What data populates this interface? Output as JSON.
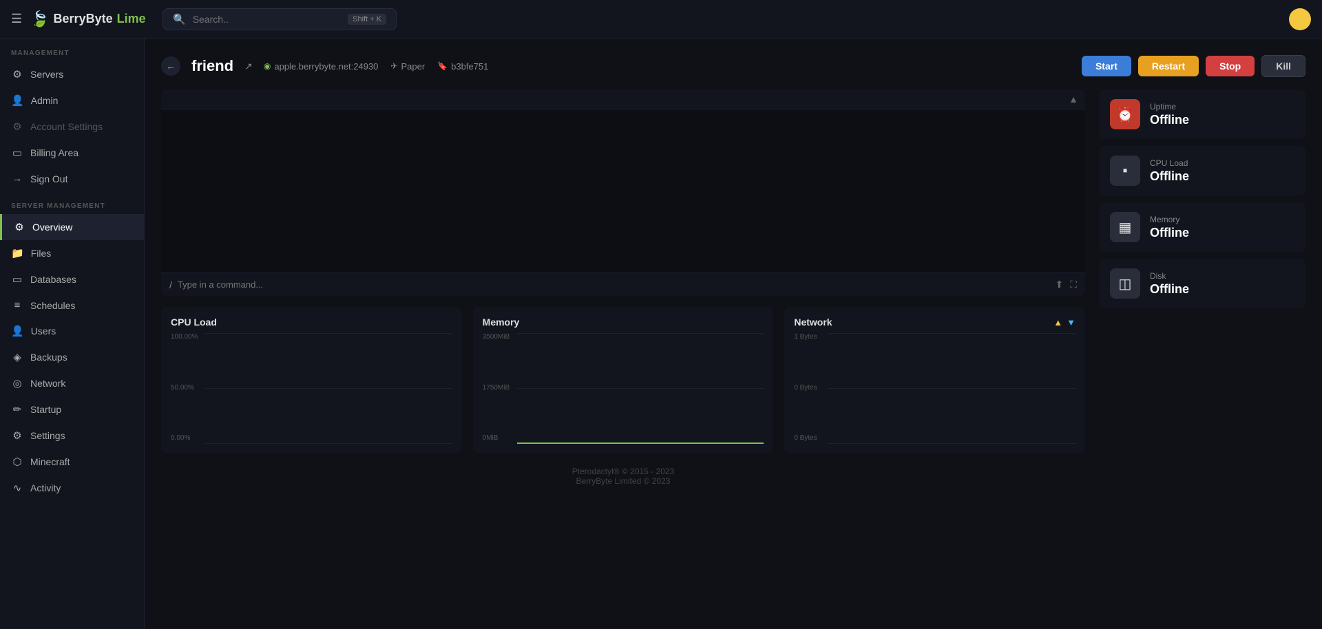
{
  "app": {
    "name": "BerryByte",
    "name_part2": "Lime",
    "logo_icon": "🍃"
  },
  "topbar": {
    "search_placeholder": "Search..",
    "search_shortcut": "Shift + K",
    "hamburger_icon": "☰"
  },
  "sidebar": {
    "management_label": "MANAGEMENT",
    "server_management_label": "SERVER MANAGEMENT",
    "items_management": [
      {
        "id": "servers",
        "label": "Servers",
        "icon": "⚙"
      },
      {
        "id": "admin",
        "label": "Admin",
        "icon": "👤"
      },
      {
        "id": "account-settings",
        "label": "Account Settings",
        "icon": "⚙",
        "dimmed": true
      },
      {
        "id": "billing-area",
        "label": "Billing Area",
        "icon": "▭"
      },
      {
        "id": "sign-out",
        "label": "Sign Out",
        "icon": "→"
      }
    ],
    "items_server": [
      {
        "id": "overview",
        "label": "Overview",
        "icon": "⚙",
        "active": true
      },
      {
        "id": "files",
        "label": "Files",
        "icon": "📁"
      },
      {
        "id": "databases",
        "label": "Databases",
        "icon": "▭"
      },
      {
        "id": "schedules",
        "label": "Schedules",
        "icon": "≡"
      },
      {
        "id": "users",
        "label": "Users",
        "icon": "👤"
      },
      {
        "id": "backups",
        "label": "Backups",
        "icon": "◈"
      },
      {
        "id": "network",
        "label": "Network",
        "icon": "◎"
      },
      {
        "id": "startup",
        "label": "Startup",
        "icon": "✏"
      },
      {
        "id": "settings",
        "label": "Settings",
        "icon": "⚙"
      },
      {
        "id": "minecraft",
        "label": "Minecraft",
        "icon": "⬡"
      },
      {
        "id": "activity",
        "label": "Activity",
        "icon": "∿"
      }
    ]
  },
  "server": {
    "name": "friend",
    "host": "apple.berrybyte.net:24930",
    "label": "Paper",
    "id": "b3bfe751",
    "external_icon": "↗",
    "back_icon": "←"
  },
  "actions": {
    "start": "Start",
    "restart": "Restart",
    "stop": "Stop",
    "kill": "Kill"
  },
  "stats": [
    {
      "id": "uptime",
      "label": "Uptime",
      "value": "Offline",
      "icon": "⏰",
      "color": "red"
    },
    {
      "id": "cpu-load",
      "label": "CPU Load",
      "value": "Offline",
      "icon": "▪",
      "color": "gray"
    },
    {
      "id": "memory",
      "label": "Memory",
      "value": "Offline",
      "icon": "▦",
      "color": "gray"
    },
    {
      "id": "disk",
      "label": "Disk",
      "value": "Offline",
      "icon": "◫",
      "color": "gray"
    }
  ],
  "console": {
    "placeholder": "Type in a command..."
  },
  "charts": [
    {
      "id": "cpu-load",
      "title": "CPU Load",
      "labels": [
        "100.00%",
        "50.00%",
        "0.00%"
      ],
      "has_green_line": false
    },
    {
      "id": "memory",
      "title": "Memory",
      "labels": [
        "3500MiB",
        "1750MiB",
        "0MiB"
      ],
      "has_green_line": true
    },
    {
      "id": "network",
      "title": "Network",
      "labels": [
        "1 Bytes",
        "0 Bytes",
        "0 Bytes"
      ],
      "has_green_line": false,
      "has_net_icons": true
    }
  ],
  "footer": {
    "line1": "Pterodactyl® © 2015 - 2023",
    "line2": "BerryByte Limited © 2023"
  }
}
